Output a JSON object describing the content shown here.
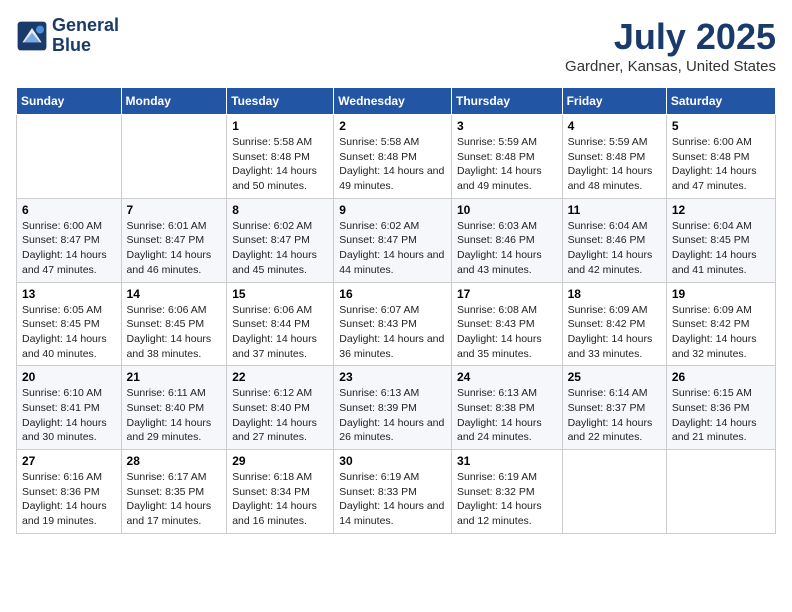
{
  "logo": {
    "line1": "General",
    "line2": "Blue"
  },
  "title": "July 2025",
  "subtitle": "Gardner, Kansas, United States",
  "weekdays": [
    "Sunday",
    "Monday",
    "Tuesday",
    "Wednesday",
    "Thursday",
    "Friday",
    "Saturday"
  ],
  "weeks": [
    [
      {
        "day": "",
        "sunrise": "",
        "sunset": "",
        "daylight": ""
      },
      {
        "day": "",
        "sunrise": "",
        "sunset": "",
        "daylight": ""
      },
      {
        "day": "1",
        "sunrise": "Sunrise: 5:58 AM",
        "sunset": "Sunset: 8:48 PM",
        "daylight": "Daylight: 14 hours and 50 minutes."
      },
      {
        "day": "2",
        "sunrise": "Sunrise: 5:58 AM",
        "sunset": "Sunset: 8:48 PM",
        "daylight": "Daylight: 14 hours and 49 minutes."
      },
      {
        "day": "3",
        "sunrise": "Sunrise: 5:59 AM",
        "sunset": "Sunset: 8:48 PM",
        "daylight": "Daylight: 14 hours and 49 minutes."
      },
      {
        "day": "4",
        "sunrise": "Sunrise: 5:59 AM",
        "sunset": "Sunset: 8:48 PM",
        "daylight": "Daylight: 14 hours and 48 minutes."
      },
      {
        "day": "5",
        "sunrise": "Sunrise: 6:00 AM",
        "sunset": "Sunset: 8:48 PM",
        "daylight": "Daylight: 14 hours and 47 minutes."
      }
    ],
    [
      {
        "day": "6",
        "sunrise": "Sunrise: 6:00 AM",
        "sunset": "Sunset: 8:47 PM",
        "daylight": "Daylight: 14 hours and 47 minutes."
      },
      {
        "day": "7",
        "sunrise": "Sunrise: 6:01 AM",
        "sunset": "Sunset: 8:47 PM",
        "daylight": "Daylight: 14 hours and 46 minutes."
      },
      {
        "day": "8",
        "sunrise": "Sunrise: 6:02 AM",
        "sunset": "Sunset: 8:47 PM",
        "daylight": "Daylight: 14 hours and 45 minutes."
      },
      {
        "day": "9",
        "sunrise": "Sunrise: 6:02 AM",
        "sunset": "Sunset: 8:47 PM",
        "daylight": "Daylight: 14 hours and 44 minutes."
      },
      {
        "day": "10",
        "sunrise": "Sunrise: 6:03 AM",
        "sunset": "Sunset: 8:46 PM",
        "daylight": "Daylight: 14 hours and 43 minutes."
      },
      {
        "day": "11",
        "sunrise": "Sunrise: 6:04 AM",
        "sunset": "Sunset: 8:46 PM",
        "daylight": "Daylight: 14 hours and 42 minutes."
      },
      {
        "day": "12",
        "sunrise": "Sunrise: 6:04 AM",
        "sunset": "Sunset: 8:45 PM",
        "daylight": "Daylight: 14 hours and 41 minutes."
      }
    ],
    [
      {
        "day": "13",
        "sunrise": "Sunrise: 6:05 AM",
        "sunset": "Sunset: 8:45 PM",
        "daylight": "Daylight: 14 hours and 40 minutes."
      },
      {
        "day": "14",
        "sunrise": "Sunrise: 6:06 AM",
        "sunset": "Sunset: 8:45 PM",
        "daylight": "Daylight: 14 hours and 38 minutes."
      },
      {
        "day": "15",
        "sunrise": "Sunrise: 6:06 AM",
        "sunset": "Sunset: 8:44 PM",
        "daylight": "Daylight: 14 hours and 37 minutes."
      },
      {
        "day": "16",
        "sunrise": "Sunrise: 6:07 AM",
        "sunset": "Sunset: 8:43 PM",
        "daylight": "Daylight: 14 hours and 36 minutes."
      },
      {
        "day": "17",
        "sunrise": "Sunrise: 6:08 AM",
        "sunset": "Sunset: 8:43 PM",
        "daylight": "Daylight: 14 hours and 35 minutes."
      },
      {
        "day": "18",
        "sunrise": "Sunrise: 6:09 AM",
        "sunset": "Sunset: 8:42 PM",
        "daylight": "Daylight: 14 hours and 33 minutes."
      },
      {
        "day": "19",
        "sunrise": "Sunrise: 6:09 AM",
        "sunset": "Sunset: 8:42 PM",
        "daylight": "Daylight: 14 hours and 32 minutes."
      }
    ],
    [
      {
        "day": "20",
        "sunrise": "Sunrise: 6:10 AM",
        "sunset": "Sunset: 8:41 PM",
        "daylight": "Daylight: 14 hours and 30 minutes."
      },
      {
        "day": "21",
        "sunrise": "Sunrise: 6:11 AM",
        "sunset": "Sunset: 8:40 PM",
        "daylight": "Daylight: 14 hours and 29 minutes."
      },
      {
        "day": "22",
        "sunrise": "Sunrise: 6:12 AM",
        "sunset": "Sunset: 8:40 PM",
        "daylight": "Daylight: 14 hours and 27 minutes."
      },
      {
        "day": "23",
        "sunrise": "Sunrise: 6:13 AM",
        "sunset": "Sunset: 8:39 PM",
        "daylight": "Daylight: 14 hours and 26 minutes."
      },
      {
        "day": "24",
        "sunrise": "Sunrise: 6:13 AM",
        "sunset": "Sunset: 8:38 PM",
        "daylight": "Daylight: 14 hours and 24 minutes."
      },
      {
        "day": "25",
        "sunrise": "Sunrise: 6:14 AM",
        "sunset": "Sunset: 8:37 PM",
        "daylight": "Daylight: 14 hours and 22 minutes."
      },
      {
        "day": "26",
        "sunrise": "Sunrise: 6:15 AM",
        "sunset": "Sunset: 8:36 PM",
        "daylight": "Daylight: 14 hours and 21 minutes."
      }
    ],
    [
      {
        "day": "27",
        "sunrise": "Sunrise: 6:16 AM",
        "sunset": "Sunset: 8:36 PM",
        "daylight": "Daylight: 14 hours and 19 minutes."
      },
      {
        "day": "28",
        "sunrise": "Sunrise: 6:17 AM",
        "sunset": "Sunset: 8:35 PM",
        "daylight": "Daylight: 14 hours and 17 minutes."
      },
      {
        "day": "29",
        "sunrise": "Sunrise: 6:18 AM",
        "sunset": "Sunset: 8:34 PM",
        "daylight": "Daylight: 14 hours and 16 minutes."
      },
      {
        "day": "30",
        "sunrise": "Sunrise: 6:19 AM",
        "sunset": "Sunset: 8:33 PM",
        "daylight": "Daylight: 14 hours and 14 minutes."
      },
      {
        "day": "31",
        "sunrise": "Sunrise: 6:19 AM",
        "sunset": "Sunset: 8:32 PM",
        "daylight": "Daylight: 14 hours and 12 minutes."
      },
      {
        "day": "",
        "sunrise": "",
        "sunset": "",
        "daylight": ""
      },
      {
        "day": "",
        "sunrise": "",
        "sunset": "",
        "daylight": ""
      }
    ]
  ]
}
